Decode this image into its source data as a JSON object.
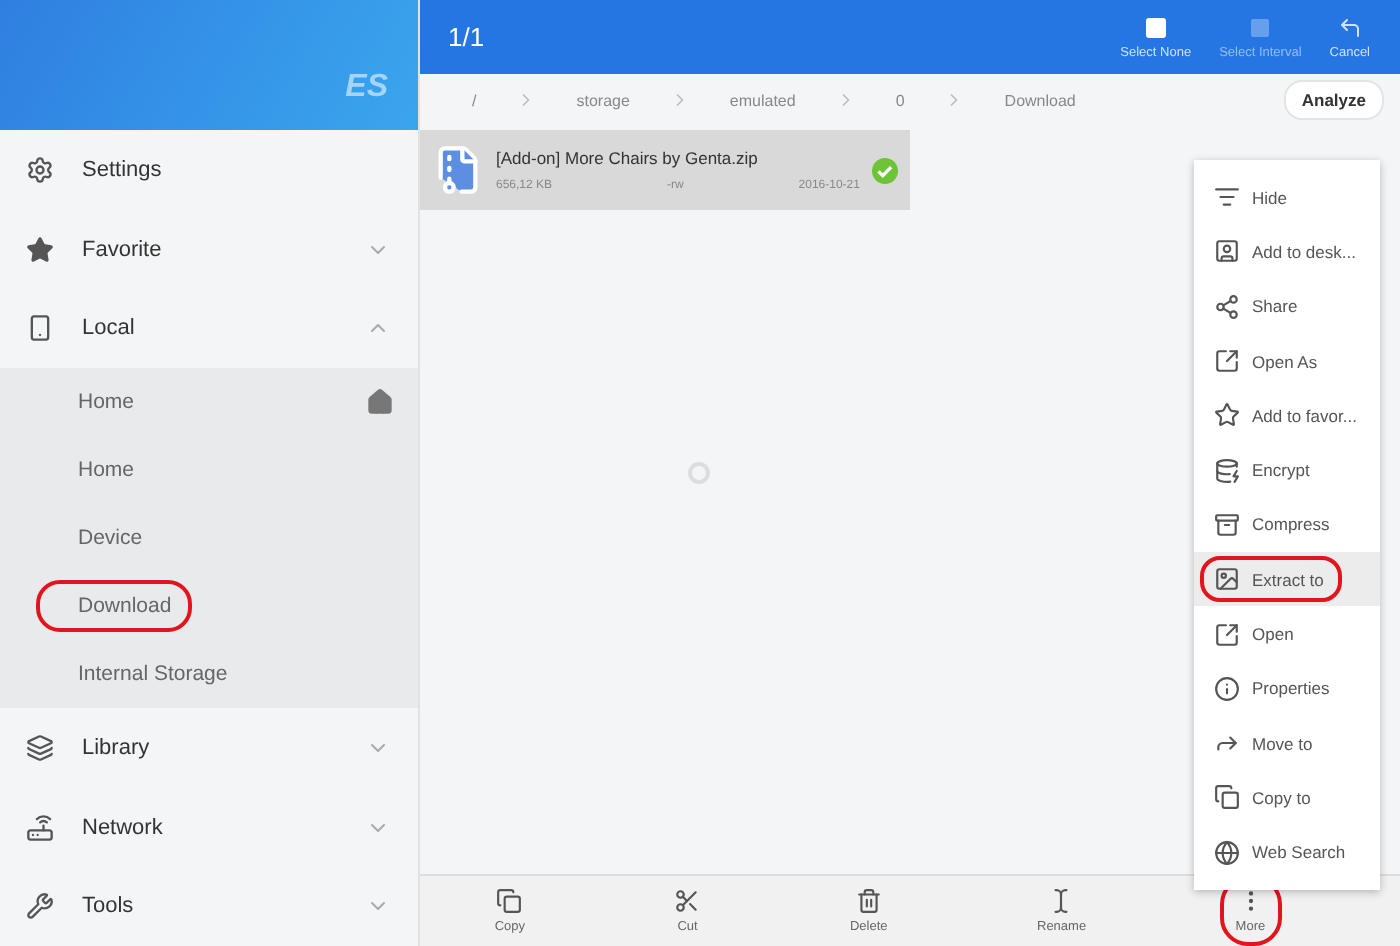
{
  "sidebar": {
    "logo": "ES",
    "items": [
      {
        "label": "Settings"
      },
      {
        "label": "Favorite",
        "expanded": false
      },
      {
        "label": "Local",
        "expanded": true,
        "children": [
          {
            "label": "Home",
            "home": true,
            "highlighted": false
          },
          {
            "label": "Home",
            "home": false,
            "highlighted": false
          },
          {
            "label": "Device",
            "home": false,
            "highlighted": false
          },
          {
            "label": "Download",
            "home": false,
            "highlighted": true
          },
          {
            "label": "Internal Storage",
            "home": false,
            "highlighted": false
          }
        ]
      },
      {
        "label": "Library",
        "expanded": false
      },
      {
        "label": "Network",
        "expanded": false
      },
      {
        "label": "Tools",
        "expanded": false
      }
    ]
  },
  "topbar": {
    "count": "1/1",
    "actions": [
      {
        "label": "Select None",
        "disabled": false
      },
      {
        "label": "Select Interval",
        "disabled": true
      },
      {
        "label": "Cancel",
        "disabled": false
      }
    ]
  },
  "breadcrumb": [
    "/",
    "storage",
    "emulated",
    "0",
    "Download"
  ],
  "analyze_button": "Analyze",
  "files": [
    {
      "name": "[Add-on] More Chairs by Genta.zip",
      "size": "656,12 KB",
      "permissions": "-rw",
      "date": "2016-10-21",
      "checked": true
    }
  ],
  "menu": [
    {
      "label": "Hide",
      "selected": false,
      "highlighted": false
    },
    {
      "label": "Add to desk...",
      "selected": false,
      "highlighted": false
    },
    {
      "label": "Share",
      "selected": false,
      "highlighted": false
    },
    {
      "label": "Open As",
      "selected": false,
      "highlighted": false
    },
    {
      "label": "Add to favor...",
      "selected": false,
      "highlighted": false
    },
    {
      "label": "Encrypt",
      "selected": false,
      "highlighted": false
    },
    {
      "label": "Compress",
      "selected": false,
      "highlighted": false
    },
    {
      "label": "Extract to",
      "selected": true,
      "highlighted": true
    },
    {
      "label": "Open",
      "selected": false,
      "highlighted": false
    },
    {
      "label": "Properties",
      "selected": false,
      "highlighted": false
    },
    {
      "label": "Move to",
      "selected": false,
      "highlighted": false
    },
    {
      "label": "Copy to",
      "selected": false,
      "highlighted": false
    },
    {
      "label": "Web Search",
      "selected": false,
      "highlighted": false
    }
  ],
  "bottom_bar": [
    {
      "label": "Copy",
      "highlighted": false
    },
    {
      "label": "Cut",
      "highlighted": false
    },
    {
      "label": "Delete",
      "highlighted": false
    },
    {
      "label": "Rename",
      "highlighted": false
    },
    {
      "label": "More",
      "highlighted": true
    }
  ]
}
